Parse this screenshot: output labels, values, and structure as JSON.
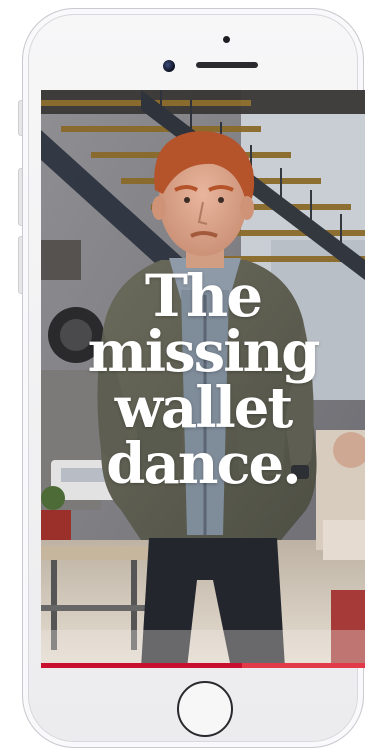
{
  "story": {
    "headline_lines": [
      "The",
      "missing",
      "wallet",
      "dance."
    ],
    "progress_fraction": 0.62
  },
  "colors": {
    "progress_bar": "#c8102e",
    "progress_track": "#e23a49",
    "headline_text": "#ffffff"
  },
  "icons": {
    "home_button": "home-button-ring",
    "front_camera": "camera-lens"
  }
}
